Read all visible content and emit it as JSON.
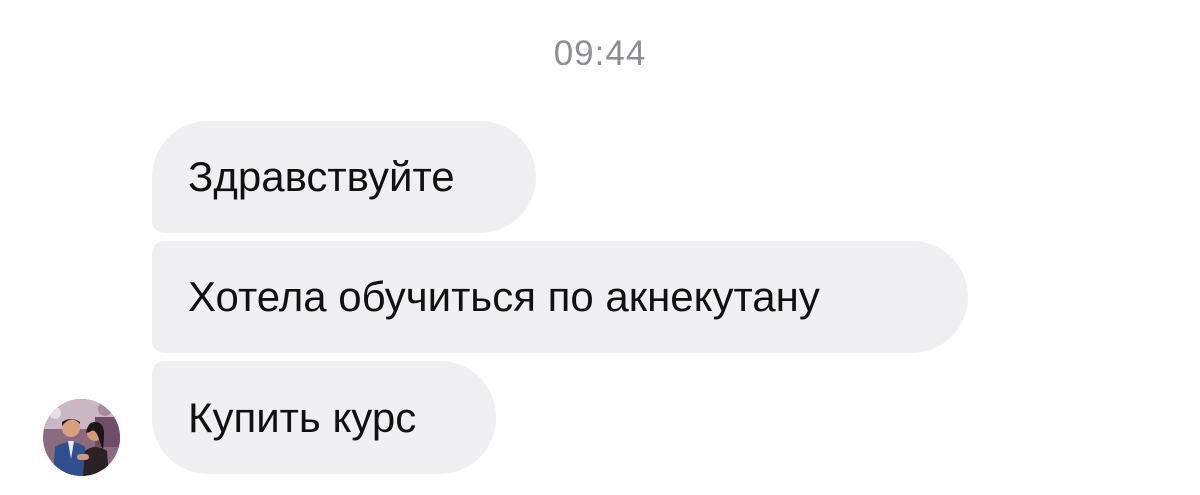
{
  "chat": {
    "timestamp": "09:44",
    "messages": [
      {
        "text": "Здравствуйте"
      },
      {
        "text": "Хотела обучиться по акнекутану"
      },
      {
        "text": "Купить курс"
      }
    ],
    "avatar_icon": "user-photo-avatar"
  },
  "colors": {
    "bubble_background": "#f0f0f2",
    "timestamp_text": "#8e8e93",
    "message_text": "#111111"
  }
}
